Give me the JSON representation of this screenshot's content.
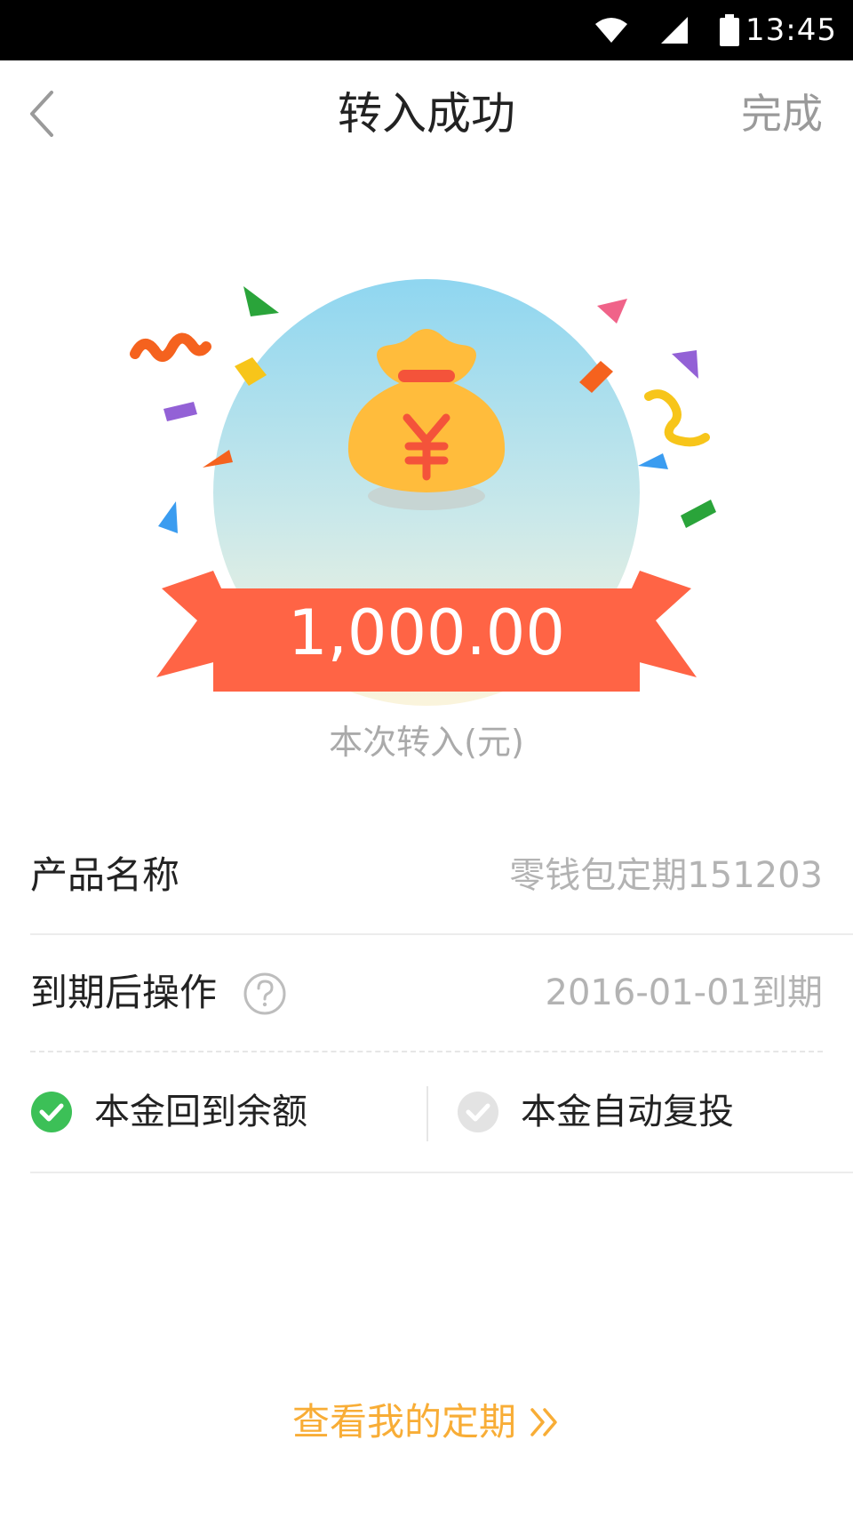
{
  "status_bar": {
    "time": "13:45",
    "icons": [
      "wifi-icon",
      "signal-icon",
      "battery-icon"
    ]
  },
  "nav": {
    "back_icon": "chevron-left-icon",
    "title": "转入成功",
    "done_label": "完成"
  },
  "hero": {
    "amount": "1,000.00",
    "caption": "本次转入(元)",
    "illustration": "money-bag-icon",
    "colors": {
      "ribbon": "#ff6445",
      "ribbon_dark": "#e8442a",
      "bag": "#ffbc3c",
      "bag_symbol": "#f4533a"
    }
  },
  "info": {
    "product_label": "产品名称",
    "product_value": "零钱包定期151203",
    "expire_label": "到期后操作",
    "expire_value": "2016-01-01到期",
    "help_icon": "question-circle-icon"
  },
  "options": [
    {
      "label": "本金回到余额",
      "selected": true
    },
    {
      "label": "本金自动复投",
      "selected": false
    }
  ],
  "footer": {
    "link_label": "查看我的定期",
    "link_icon": "double-chevron-right-icon",
    "link_color": "#f8ad36"
  },
  "accent_colors": {
    "success_green": "#3cc057"
  }
}
